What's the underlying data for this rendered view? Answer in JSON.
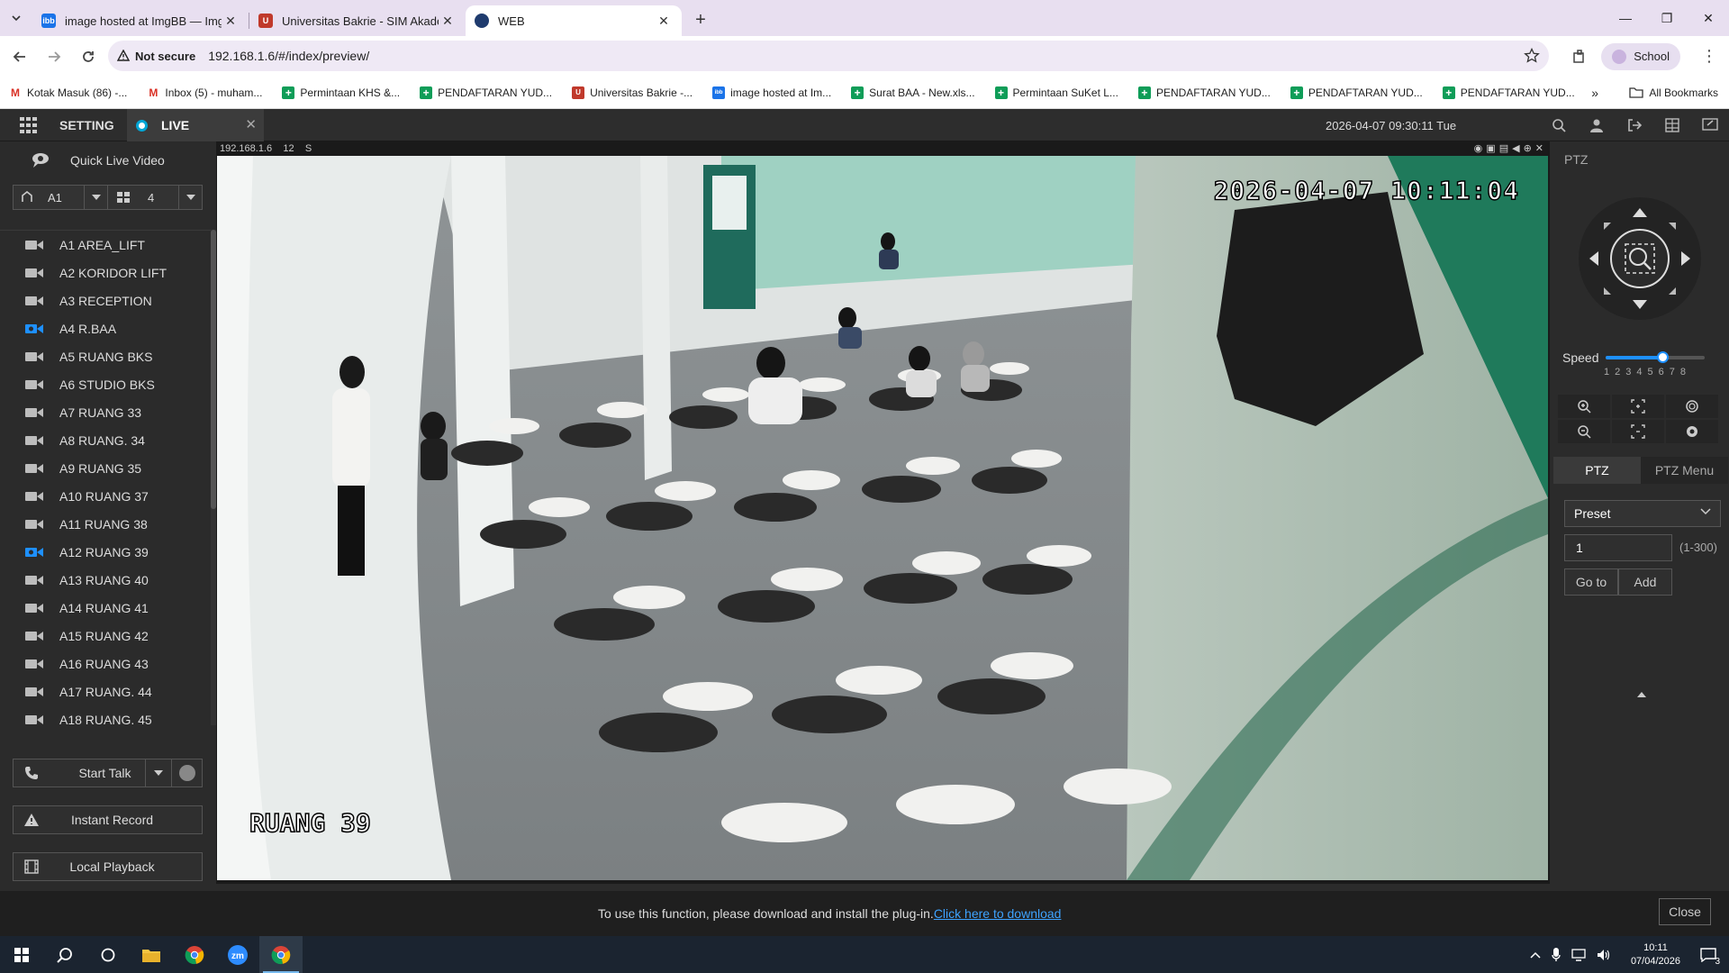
{
  "browser": {
    "tabs": [
      {
        "title": "image hosted at ImgBB — ImgBB",
        "favicon": "ibb-icon",
        "color": "#1a73e8"
      },
      {
        "title": "Universitas Bakrie - SIM Akademik",
        "favicon": "shield-icon",
        "color": "#c0392b"
      },
      {
        "title": "WEB",
        "favicon": "globe-icon",
        "color": "#1f3b6e"
      }
    ],
    "address": {
      "security_label": "Not secure",
      "url": "192.168.1.6/#/index/preview/"
    },
    "profile_label": "School",
    "bookmarks": [
      {
        "label": "Kotak Masuk (86) -...",
        "icon": "gmail-icon",
        "color": "#d93025"
      },
      {
        "label": "Inbox (5) - muham...",
        "icon": "gmail-icon",
        "color": "#d93025"
      },
      {
        "label": "Permintaan KHS &...",
        "icon": "sheets-icon",
        "color": "#0f9d58"
      },
      {
        "label": "PENDAFTARAN YUD...",
        "icon": "sheets-icon",
        "color": "#0f9d58"
      },
      {
        "label": "Universitas Bakrie -...",
        "icon": "shield-icon",
        "color": "#c0392b"
      },
      {
        "label": "image hosted at Im...",
        "icon": "ibb-icon",
        "color": "#1a73e8"
      },
      {
        "label": "Surat BAA - New.xls...",
        "icon": "sheets-icon",
        "color": "#0f9d58"
      },
      {
        "label": "Permintaan SuKet L...",
        "icon": "sheets-icon",
        "color": "#0f9d58"
      },
      {
        "label": "PENDAFTARAN YUD...",
        "icon": "sheets-icon",
        "color": "#0f9d58"
      },
      {
        "label": "PENDAFTARAN YUD...",
        "icon": "sheets-icon",
        "color": "#0f9d58"
      },
      {
        "label": "PENDAFTARAN YUD...",
        "icon": "sheets-icon",
        "color": "#0f9d58"
      }
    ],
    "all_bookmarks_label": "All Bookmarks"
  },
  "app": {
    "setting_label": "SETTING",
    "live_label": "LIVE",
    "datetime": "2026-04-07 09:30:11 Tue",
    "quick_live_label": "Quick Live Video",
    "channel_select": "A1",
    "split_select": "4",
    "devices": [
      {
        "label": "A1 AREA_LIFT",
        "active": false
      },
      {
        "label": "A2 KORIDOR LIFT",
        "active": false
      },
      {
        "label": "A3 RECEPTION",
        "active": false
      },
      {
        "label": "A4 R.BAA",
        "active": true
      },
      {
        "label": "A5 RUANG BKS",
        "active": false
      },
      {
        "label": "A6 STUDIO BKS",
        "active": false
      },
      {
        "label": "A7 RUANG 33",
        "active": false
      },
      {
        "label": "A8 RUANG. 34",
        "active": false
      },
      {
        "label": "A9 RUANG 35",
        "active": false
      },
      {
        "label": "A10 RUANG 37",
        "active": false
      },
      {
        "label": "A11 RUANG 38",
        "active": false
      },
      {
        "label": "A12 RUANG 39",
        "active": true
      },
      {
        "label": "A13 RUANG 40",
        "active": false
      },
      {
        "label": "A14 RUANG 41",
        "active": false
      },
      {
        "label": "A15 RUANG 42",
        "active": false
      },
      {
        "label": "A16 RUANG 43",
        "active": false
      },
      {
        "label": "A17 RUANG. 44",
        "active": false
      },
      {
        "label": "A18 RUANG. 45",
        "active": false
      }
    ],
    "start_talk_label": "Start Talk",
    "instant_record_label": "Instant Record",
    "local_playback_label": "Local Playback",
    "video": {
      "info_ip": "192.168.1.6",
      "info_channel": "12",
      "info_stream": "S",
      "osd_time": "2026-04-07 10:11:04",
      "osd_name": "RUANG 39"
    },
    "ptz": {
      "title": "PTZ",
      "speed_label": "Speed",
      "speed_levels": [
        "1",
        "2",
        "3",
        "4",
        "5",
        "6",
        "7",
        "8"
      ],
      "speed_value": 5,
      "tab_ptz": "PTZ",
      "tab_menu": "PTZ Menu",
      "preset_label": "Preset",
      "preset_value": "1",
      "preset_range": "(1-300)",
      "goto_label": "Go to",
      "add_label": "Add"
    },
    "plugin": {
      "message": "To use this function, please download and install the plug-in.",
      "link": "Click here to download",
      "close_label": "Close"
    }
  },
  "taskbar": {
    "time": "10:11",
    "date": "07/04/2026",
    "notifications": "3"
  },
  "colors": {
    "accent": "#1e90ff",
    "active_camera": "#1e90ff",
    "live_dot": "#00a6d6",
    "link": "#3ea3ff"
  }
}
